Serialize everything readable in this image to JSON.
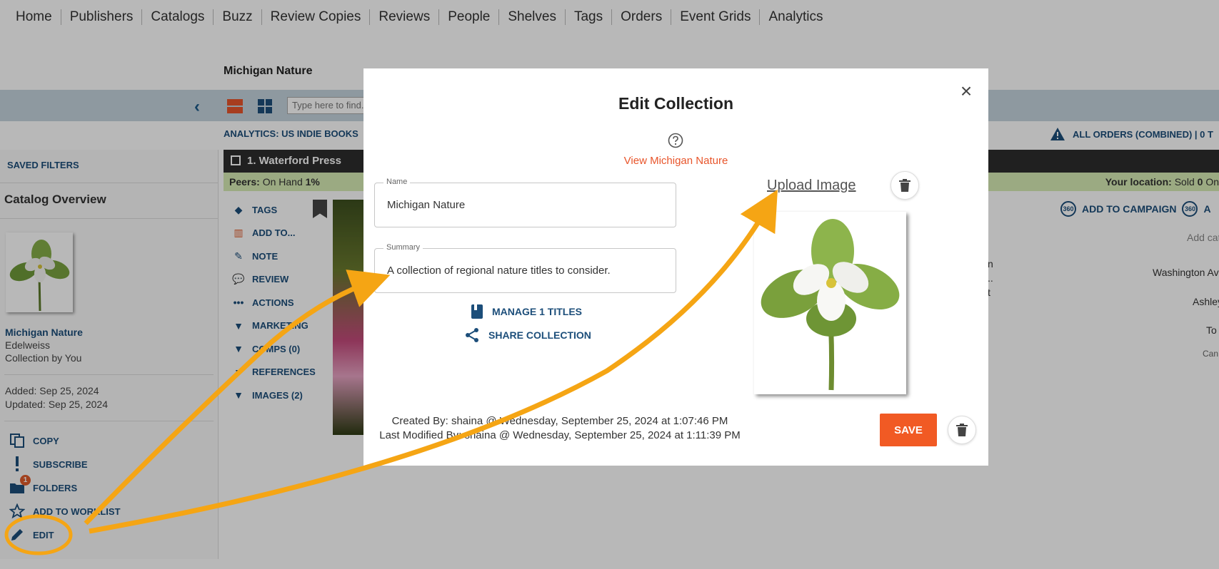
{
  "topnav": {
    "items": [
      "Home",
      "Publishers",
      "Catalogs",
      "Buzz",
      "Review Copies",
      "Reviews",
      "People",
      "Shelves",
      "Tags",
      "Orders",
      "Event Grids",
      "Analytics"
    ]
  },
  "page": {
    "title": "Michigan Nature",
    "search_placeholder": "Type here to find...",
    "analytics_label": "ANALYTICS: US INDIE BOOKS",
    "orders_label": "ALL ORDERS (COMBINED) | 0 T"
  },
  "sidebar": {
    "saved_filters": "SAVED FILTERS",
    "catalog_overview": "Catalog Overview",
    "collection_name": "Michigan Nature",
    "publisher": "Edelweiss",
    "owner": "Collection by You",
    "added": "Added: Sep 25, 2024",
    "updated": "Updated: Sep 25, 2024",
    "actions": [
      {
        "label": "COPY",
        "icon": "copy-icon"
      },
      {
        "label": "SUBSCRIBE",
        "icon": "exclamation-icon"
      },
      {
        "label": "FOLDERS",
        "icon": "folder-icon",
        "badge": "1"
      },
      {
        "label": "ADD TO WORKLIST",
        "icon": "star-icon"
      },
      {
        "label": "EDIT",
        "icon": "pencil-icon"
      }
    ]
  },
  "title_row": {
    "title": "1. Waterford Press",
    "peers_label": "Peers:",
    "peers_value": "On Hand",
    "peers_pct": "1%",
    "location": "Your location:",
    "location_value": "Sold",
    "location_count": "0",
    "location_more": "On"
  },
  "item_actions": [
    "TAGS",
    "ADD TO...",
    "NOTE",
    "REVIEW",
    "ACTIONS",
    "MARKETING",
    "COMPS (0)",
    "REFERENCES",
    "IMAGES (2)"
  ],
  "right_cols": {
    "add_campaign": "ADD TO CAMPAIGN",
    "a_label": "A",
    "add_cat": "Add cat",
    "washington": "Washington Av",
    "ashley": "Ashley",
    "to": "To",
    "can": "Can",
    "frag1": "n",
    "frag2": "..",
    "frag3": "t"
  },
  "modal": {
    "title": "Edit Collection",
    "view_link": "View Michigan Nature",
    "name_label": "Name",
    "name_value": "Michigan Nature",
    "summary_label": "Summary",
    "summary_value": "A collection of regional nature titles to consider.",
    "manage_titles": "MANAGE 1 TITLES",
    "share_collection": "SHARE COLLECTION",
    "upload_image": "Upload Image",
    "created_by": "Created By: shaina @ Wednesday, September 25, 2024 at 1:07:46 PM",
    "modified_by": "Last Modified By: shaina @ Wednesday, September 25, 2024 at 1:11:39 PM",
    "save": "SAVE"
  },
  "colors": {
    "accent": "#f15a24",
    "link": "#1c4e7a",
    "annotation": "#f5a514"
  }
}
